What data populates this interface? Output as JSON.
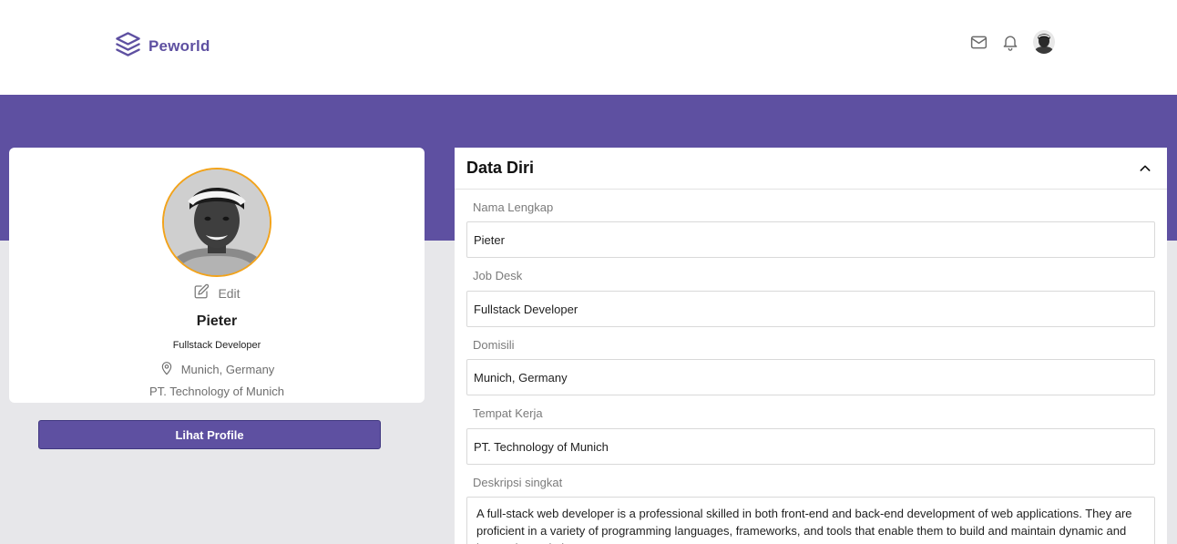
{
  "navbar": {
    "brand": "Peworld",
    "icons": [
      "layers-logo-icon",
      "mail-icon",
      "bell-icon",
      "user-avatar"
    ]
  },
  "colors": {
    "primary": "#5e50a1",
    "accent_ring": "#f2a31b",
    "page_bg": "#e7e7ea"
  },
  "profile": {
    "edit_label": "Edit",
    "name": "Pieter",
    "job": "Fullstack Developer",
    "location": "Munich, Germany",
    "company": "PT. Technology of Munich",
    "view_button": "Lihat Profile"
  },
  "form": {
    "title": "Data Diri",
    "fields": [
      {
        "label": "Nama Lengkap",
        "value": "Pieter"
      },
      {
        "label": "Job Desk",
        "value": "Fullstack Developer"
      },
      {
        "label": "Domisili",
        "value": "Munich, Germany"
      },
      {
        "label": "Tempat Kerja",
        "value": "PT. Technology of Munich"
      }
    ],
    "description": {
      "label": "Deskripsi singkat",
      "value": "A full-stack web developer is a professional skilled in both front-end and back-end development of web applications. They are proficient in a variety of programming languages, frameworks, and tools that enable them to build and maintain dynamic and interactive websites."
    }
  }
}
